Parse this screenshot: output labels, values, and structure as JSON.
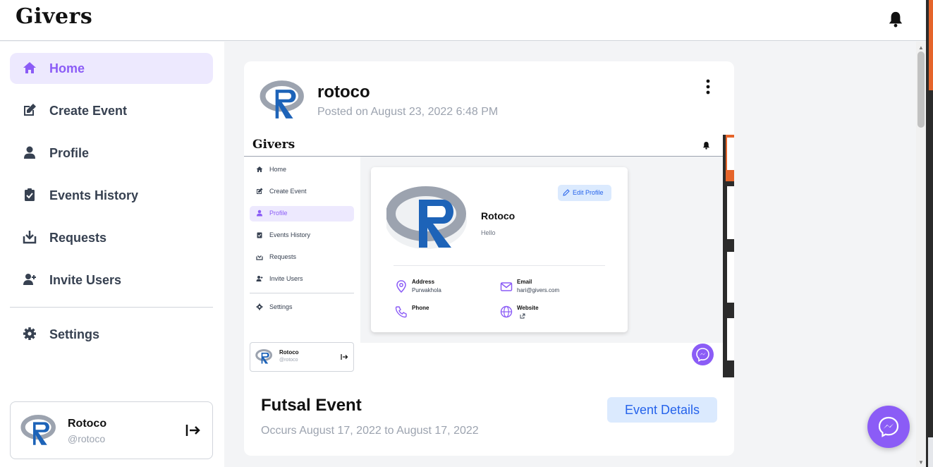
{
  "app": {
    "brand": "Givers"
  },
  "colors": {
    "accent": "#8b5cf6",
    "accent_bg": "#ede9fe",
    "button_bg": "#dbeafe",
    "button_text": "#2563eb"
  },
  "sidebar": {
    "items": [
      {
        "label": "Home",
        "icon": "home-icon",
        "active": true
      },
      {
        "label": "Create Event",
        "icon": "edit-icon",
        "active": false
      },
      {
        "label": "Profile",
        "icon": "user-icon",
        "active": false
      },
      {
        "label": "Events History",
        "icon": "clipboard-check-icon",
        "active": false
      },
      {
        "label": "Requests",
        "icon": "download-box-icon",
        "active": false
      },
      {
        "label": "Invite Users",
        "icon": "user-plus-icon",
        "active": false
      }
    ],
    "settings": {
      "label": "Settings",
      "icon": "gear-icon"
    },
    "user": {
      "name": "Rotoco",
      "handle": "@rotoco"
    }
  },
  "post": {
    "author": "rotoco",
    "posted": "Posted on August 23, 2022 6:48 PM",
    "event": {
      "title": "Futsal Event",
      "dates": "Occurs August 17, 2022 to August 17, 2022",
      "details_button": "Event Details"
    },
    "screenshot": {
      "brand": "Givers",
      "nav": [
        "Home",
        "Create Event",
        "Profile",
        "Events History",
        "Requests",
        "Invite Users"
      ],
      "settings": "Settings",
      "user": {
        "name": "Rotoco",
        "handle": "@rotoco"
      },
      "profile": {
        "name": "Rotoco",
        "bio": "Hello",
        "edit_button": "Edit Profile",
        "address_label": "Address",
        "address_value": "Purwakhola",
        "email_label": "Email",
        "email_value": "hari@givers.com",
        "phone_label": "Phone",
        "website_label": "Website"
      }
    }
  }
}
